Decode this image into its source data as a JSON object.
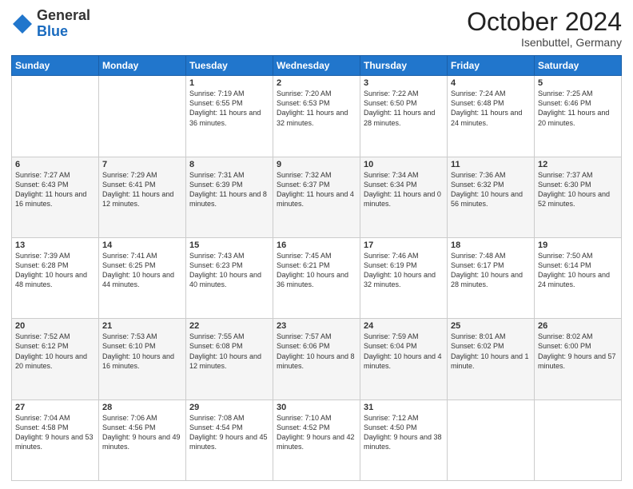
{
  "logo": {
    "general": "General",
    "blue": "Blue"
  },
  "header": {
    "month": "October 2024",
    "location": "Isenbuttel, Germany"
  },
  "days_of_week": [
    "Sunday",
    "Monday",
    "Tuesday",
    "Wednesday",
    "Thursday",
    "Friday",
    "Saturday"
  ],
  "weeks": [
    [
      {
        "day": "",
        "text": ""
      },
      {
        "day": "",
        "text": ""
      },
      {
        "day": "1",
        "text": "Sunrise: 7:19 AM\nSunset: 6:55 PM\nDaylight: 11 hours and 36 minutes."
      },
      {
        "day": "2",
        "text": "Sunrise: 7:20 AM\nSunset: 6:53 PM\nDaylight: 11 hours and 32 minutes."
      },
      {
        "day": "3",
        "text": "Sunrise: 7:22 AM\nSunset: 6:50 PM\nDaylight: 11 hours and 28 minutes."
      },
      {
        "day": "4",
        "text": "Sunrise: 7:24 AM\nSunset: 6:48 PM\nDaylight: 11 hours and 24 minutes."
      },
      {
        "day": "5",
        "text": "Sunrise: 7:25 AM\nSunset: 6:46 PM\nDaylight: 11 hours and 20 minutes."
      }
    ],
    [
      {
        "day": "6",
        "text": "Sunrise: 7:27 AM\nSunset: 6:43 PM\nDaylight: 11 hours and 16 minutes."
      },
      {
        "day": "7",
        "text": "Sunrise: 7:29 AM\nSunset: 6:41 PM\nDaylight: 11 hours and 12 minutes."
      },
      {
        "day": "8",
        "text": "Sunrise: 7:31 AM\nSunset: 6:39 PM\nDaylight: 11 hours and 8 minutes."
      },
      {
        "day": "9",
        "text": "Sunrise: 7:32 AM\nSunset: 6:37 PM\nDaylight: 11 hours and 4 minutes."
      },
      {
        "day": "10",
        "text": "Sunrise: 7:34 AM\nSunset: 6:34 PM\nDaylight: 11 hours and 0 minutes."
      },
      {
        "day": "11",
        "text": "Sunrise: 7:36 AM\nSunset: 6:32 PM\nDaylight: 10 hours and 56 minutes."
      },
      {
        "day": "12",
        "text": "Sunrise: 7:37 AM\nSunset: 6:30 PM\nDaylight: 10 hours and 52 minutes."
      }
    ],
    [
      {
        "day": "13",
        "text": "Sunrise: 7:39 AM\nSunset: 6:28 PM\nDaylight: 10 hours and 48 minutes."
      },
      {
        "day": "14",
        "text": "Sunrise: 7:41 AM\nSunset: 6:25 PM\nDaylight: 10 hours and 44 minutes."
      },
      {
        "day": "15",
        "text": "Sunrise: 7:43 AM\nSunset: 6:23 PM\nDaylight: 10 hours and 40 minutes."
      },
      {
        "day": "16",
        "text": "Sunrise: 7:45 AM\nSunset: 6:21 PM\nDaylight: 10 hours and 36 minutes."
      },
      {
        "day": "17",
        "text": "Sunrise: 7:46 AM\nSunset: 6:19 PM\nDaylight: 10 hours and 32 minutes."
      },
      {
        "day": "18",
        "text": "Sunrise: 7:48 AM\nSunset: 6:17 PM\nDaylight: 10 hours and 28 minutes."
      },
      {
        "day": "19",
        "text": "Sunrise: 7:50 AM\nSunset: 6:14 PM\nDaylight: 10 hours and 24 minutes."
      }
    ],
    [
      {
        "day": "20",
        "text": "Sunrise: 7:52 AM\nSunset: 6:12 PM\nDaylight: 10 hours and 20 minutes."
      },
      {
        "day": "21",
        "text": "Sunrise: 7:53 AM\nSunset: 6:10 PM\nDaylight: 10 hours and 16 minutes."
      },
      {
        "day": "22",
        "text": "Sunrise: 7:55 AM\nSunset: 6:08 PM\nDaylight: 10 hours and 12 minutes."
      },
      {
        "day": "23",
        "text": "Sunrise: 7:57 AM\nSunset: 6:06 PM\nDaylight: 10 hours and 8 minutes."
      },
      {
        "day": "24",
        "text": "Sunrise: 7:59 AM\nSunset: 6:04 PM\nDaylight: 10 hours and 4 minutes."
      },
      {
        "day": "25",
        "text": "Sunrise: 8:01 AM\nSunset: 6:02 PM\nDaylight: 10 hours and 1 minute."
      },
      {
        "day": "26",
        "text": "Sunrise: 8:02 AM\nSunset: 6:00 PM\nDaylight: 9 hours and 57 minutes."
      }
    ],
    [
      {
        "day": "27",
        "text": "Sunrise: 7:04 AM\nSunset: 4:58 PM\nDaylight: 9 hours and 53 minutes."
      },
      {
        "day": "28",
        "text": "Sunrise: 7:06 AM\nSunset: 4:56 PM\nDaylight: 9 hours and 49 minutes."
      },
      {
        "day": "29",
        "text": "Sunrise: 7:08 AM\nSunset: 4:54 PM\nDaylight: 9 hours and 45 minutes."
      },
      {
        "day": "30",
        "text": "Sunrise: 7:10 AM\nSunset: 4:52 PM\nDaylight: 9 hours and 42 minutes."
      },
      {
        "day": "31",
        "text": "Sunrise: 7:12 AM\nSunset: 4:50 PM\nDaylight: 9 hours and 38 minutes."
      },
      {
        "day": "",
        "text": ""
      },
      {
        "day": "",
        "text": ""
      }
    ]
  ]
}
